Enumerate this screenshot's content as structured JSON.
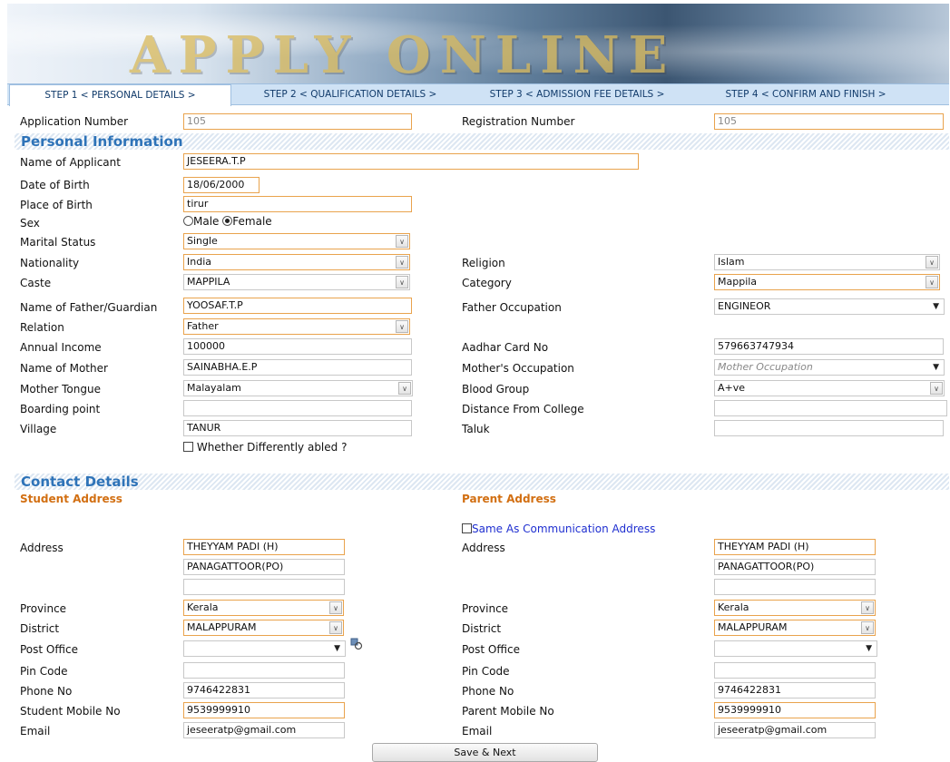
{
  "banner": {
    "title": "APPLY ONLINE"
  },
  "tabs": [
    {
      "label": "STEP 1 < PERSONAL DETAILS >"
    },
    {
      "label": "STEP 2 < QUALIFICATION DETAILS >"
    },
    {
      "label": "STEP 3 < ADMISSION FEE DETAILS >"
    },
    {
      "label": "STEP 4 < CONFIRM AND FINISH >"
    }
  ],
  "application": {
    "application_number_label": "Application Number",
    "application_number": "105",
    "registration_number_label": "Registration Number",
    "registration_number": "105"
  },
  "personal": {
    "heading": "Personal Information",
    "name_label": "Name of Applicant",
    "name": "JESEERA.T.P",
    "dob_label": "Date of Birth",
    "dob": "18/06/2000",
    "pob_label": "Place of Birth",
    "pob": "tirur",
    "sex_label": "Sex",
    "sex_male": "Male",
    "sex_female": "Female",
    "marital_label": "Marital Status",
    "marital": "Single",
    "nationality_label": "Nationality",
    "nationality": "India",
    "religion_label": "Religion",
    "religion": "Islam",
    "caste_label": "Caste",
    "caste": "MAPPILA",
    "category_label": "Category",
    "category": "Mappila",
    "father_label": "Name of Father/Guardian",
    "father": "YOOSAF.T.P",
    "father_occ_label": "Father Occupation",
    "father_occ": "ENGINEOR",
    "relation_label": "Relation",
    "relation": "Father",
    "income_label": "Annual Income",
    "income": "100000",
    "aadhar_label": "Aadhar Card No",
    "aadhar": "579663747934",
    "mother_label": "Name of Mother",
    "mother": "SAINABHA.E.P",
    "mother_occ_label": "Mother's Occupation",
    "mother_occ_placeholder": "Mother Occupation",
    "tongue_label": "Mother Tongue",
    "tongue": "Malayalam",
    "blood_label": "Blood Group",
    "blood": "A+ve",
    "boarding_label": "Boarding point",
    "boarding": "",
    "distance_label": "Distance From College",
    "distance": "",
    "village_label": "Village",
    "village": "TANUR",
    "taluk_label": "Taluk",
    "taluk": "",
    "disabled_label": "Whether Differently abled ?"
  },
  "contact": {
    "heading": "Contact Details",
    "student_heading": "Student Address",
    "parent_heading": "Parent Address",
    "same_as_label": "Same As Communication Address",
    "address_label": "Address",
    "province_label": "Province",
    "district_label": "District",
    "post_office_label": "Post Office",
    "pin_label": "Pin Code",
    "phone_label": "Phone No",
    "student_mobile_label": "Student Mobile No",
    "parent_mobile_label": "Parent Mobile No",
    "email_label": "Email",
    "student": {
      "address1": "THEYYAM PADI (H)",
      "address2": "PANAGATTOOR(PO)",
      "address3": "",
      "province": "Kerala",
      "district": "MALAPPURAM",
      "post_office": "",
      "pin": "",
      "phone": "9746422831",
      "mobile": "9539999910",
      "email": "jeseeratp@gmail.com"
    },
    "parent": {
      "address1": "THEYYAM PADI (H)",
      "address2": "PANAGATTOOR(PO)",
      "address3": "",
      "province": "Kerala",
      "district": "MALAPPURAM",
      "post_office": "",
      "pin": "",
      "phone": "9746422831",
      "mobile": "9539999910",
      "email": "jeseeratp@gmail.com"
    }
  },
  "actions": {
    "save_next": "Save & Next"
  }
}
